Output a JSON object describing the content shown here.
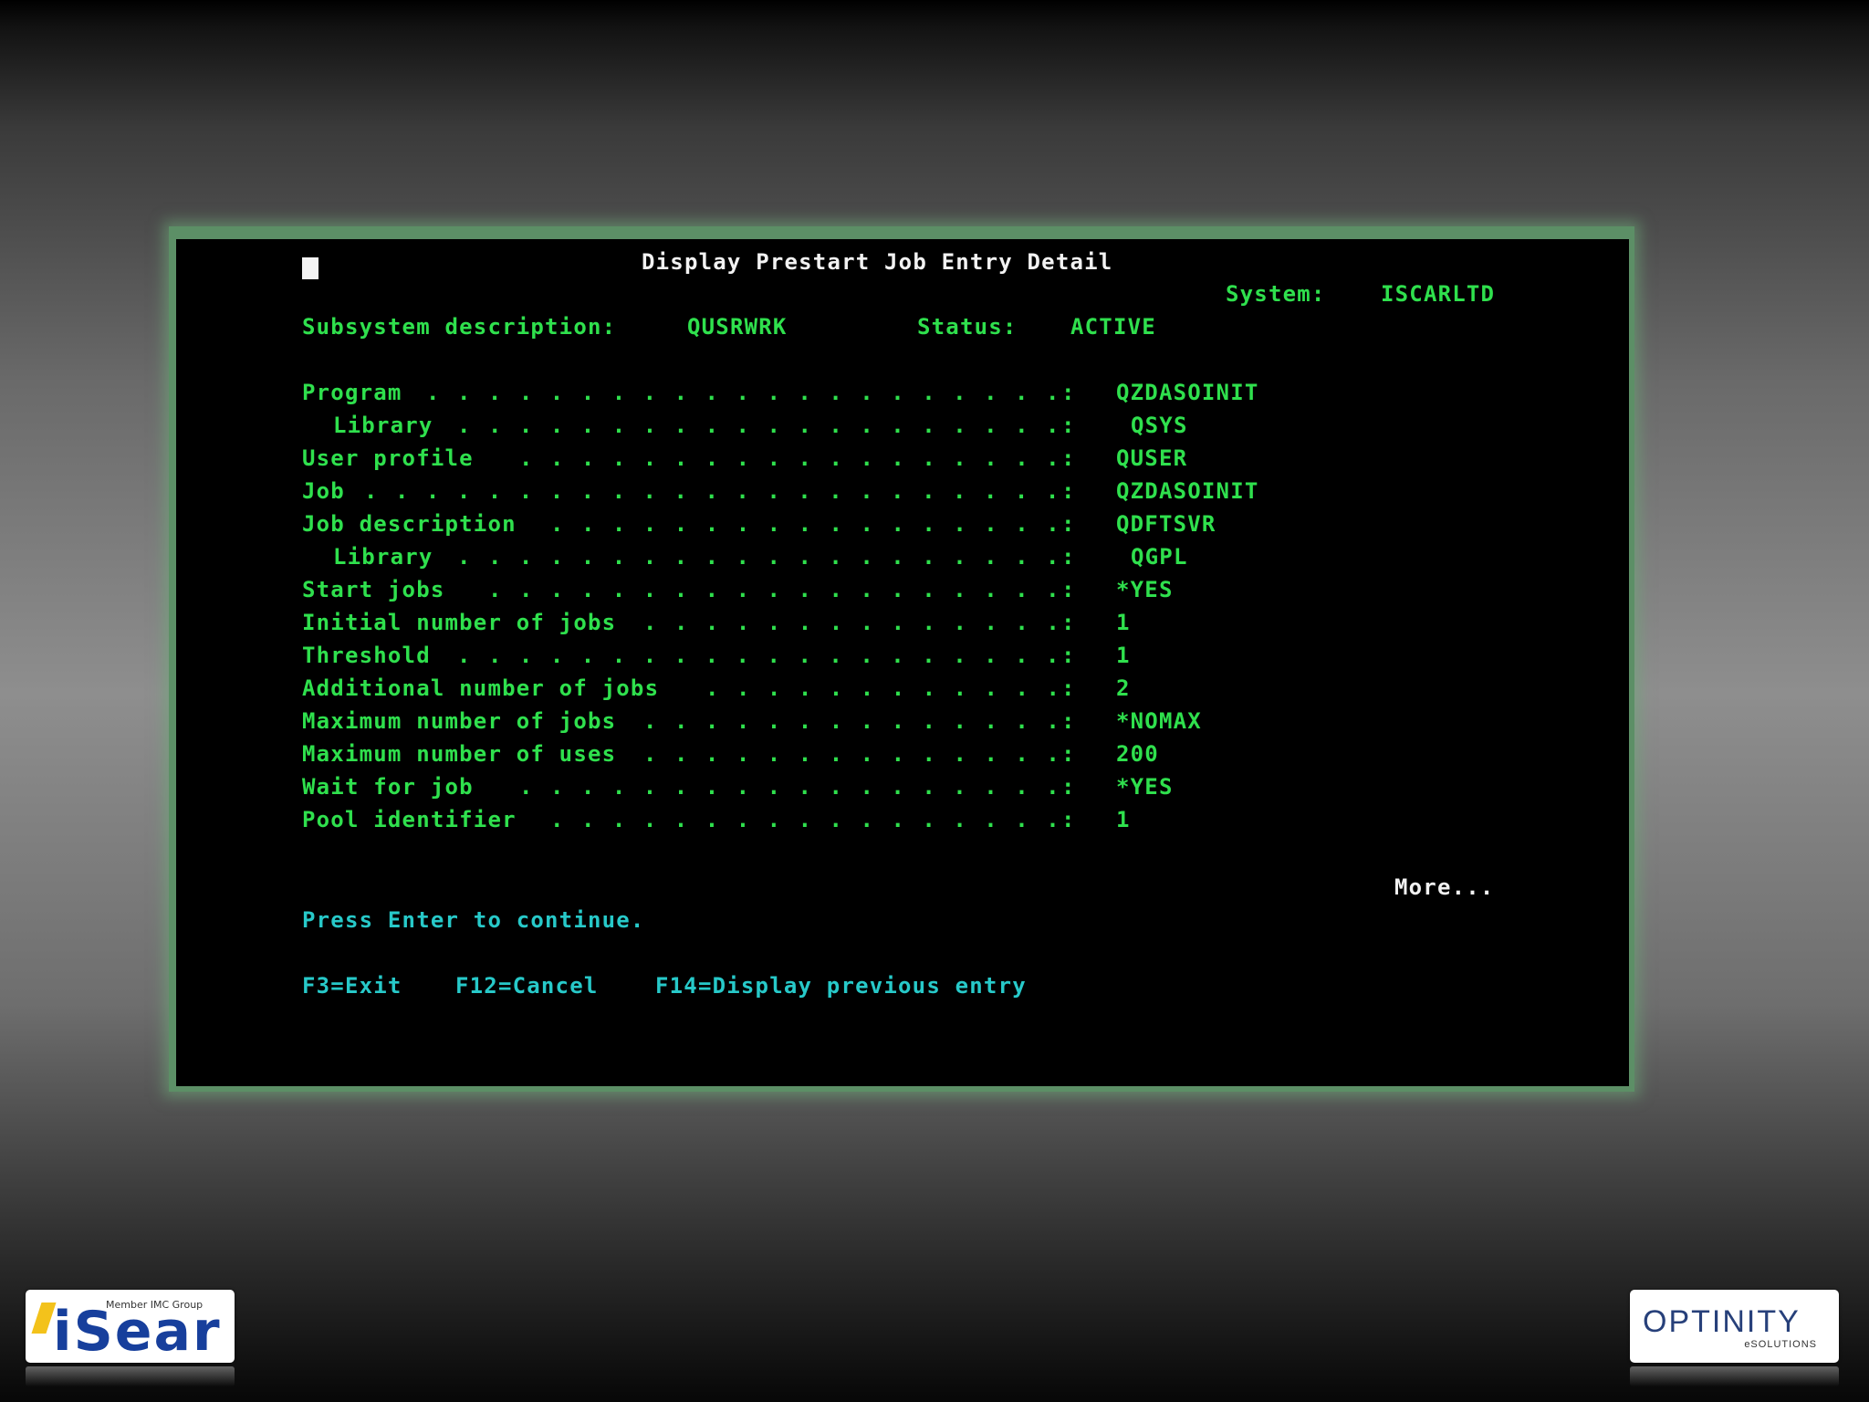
{
  "screen": {
    "title": "Display Prestart Job Entry Detail",
    "system_label": "System:",
    "system_value": "ISCARLTD",
    "subsystem_label": "Subsystem description:",
    "subsystem_value": "QUSRWRK",
    "status_label": "Status:",
    "status_value": "ACTIVE",
    "fields": [
      {
        "label": "Program",
        "value": "QZDASOINIT",
        "indent": false
      },
      {
        "label": "Library",
        "value": "QSYS",
        "indent": true
      },
      {
        "label": "User profile",
        "value": "QUSER",
        "indent": false
      },
      {
        "label": "Job",
        "value": "QZDASOINIT",
        "indent": false
      },
      {
        "label": "Job description",
        "value": "QDFTSVR",
        "indent": false
      },
      {
        "label": "Library",
        "value": "QGPL",
        "indent": true
      },
      {
        "label": "Start jobs",
        "value": "*YES",
        "indent": false
      },
      {
        "label": "Initial number of jobs",
        "value": "1",
        "indent": false
      },
      {
        "label": "Threshold",
        "value": "1",
        "indent": false
      },
      {
        "label": "Additional number of jobs",
        "value": "2",
        "indent": false
      },
      {
        "label": "Maximum number of jobs",
        "value": "*NOMAX",
        "indent": false
      },
      {
        "label": "Maximum number of uses",
        "value": "200",
        "indent": false
      },
      {
        "label": "Wait for job",
        "value": "*YES",
        "indent": false
      },
      {
        "label": "Pool identifier",
        "value": "1",
        "indent": false
      }
    ],
    "more": "More...",
    "prompt": "Press Enter to continue.",
    "function_keys": [
      {
        "label": "F3=Exit"
      },
      {
        "label": "F12=Cancel"
      },
      {
        "label": "F14=Display previous entry"
      }
    ]
  },
  "logos": {
    "left": {
      "text": "iSear",
      "member": "Member IMC Group"
    },
    "right": {
      "text": "OPTINITY",
      "sub": "eSOLUTIONS"
    }
  },
  "colors": {
    "field_green": "#2fe04d",
    "title_white": "#f2f2f2",
    "prompt_cyan": "#27c9c9",
    "frame_glow": "#5c8f66"
  }
}
